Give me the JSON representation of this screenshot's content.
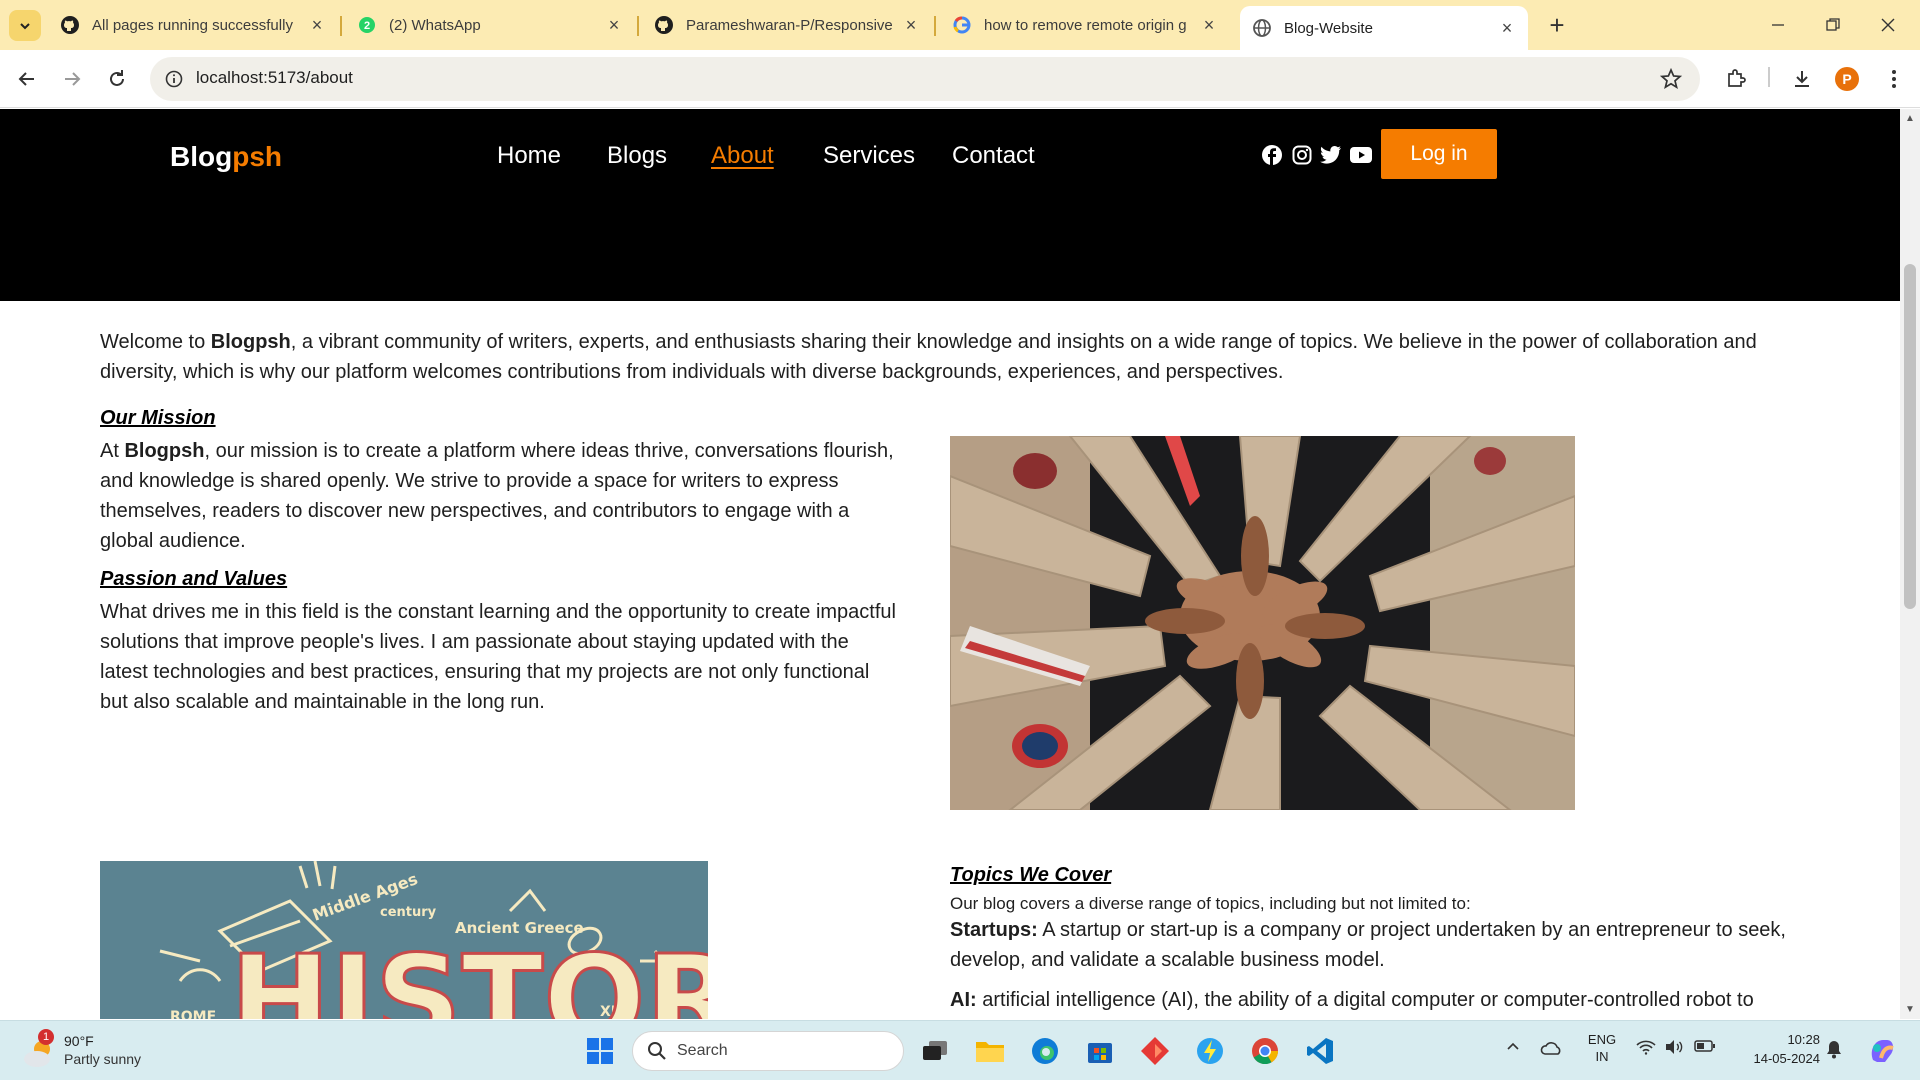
{
  "browser": {
    "tabs": [
      {
        "title": "All pages running successfully ·",
        "icon": "github-icon"
      },
      {
        "title": "(2) WhatsApp",
        "icon": "whatsapp-icon"
      },
      {
        "title": "Parameshwaran-P/Responsive-I",
        "icon": "github-icon"
      },
      {
        "title": "how to remove remote origin g",
        "icon": "google-icon"
      },
      {
        "title": "Blog-Website",
        "icon": "globe-icon",
        "active": true
      }
    ],
    "url": "localhost:5173/about",
    "profile_initial": "P"
  },
  "site": {
    "logo_main": "Blog",
    "logo_accent": "psh",
    "nav": [
      "Home",
      "Blogs",
      "About",
      "Services",
      "Contact"
    ],
    "active_nav": "About",
    "login_label": "Log in",
    "accent_color": "#f57c00"
  },
  "content": {
    "intro_pre": "Welcome to ",
    "brand": "Blogpsh",
    "intro_post": ", a vibrant community of writers, experts, and enthusiasts sharing their knowledge and insights on a wide range of topics. We believe in the power of collaboration and diversity, which is why our platform welcomes contributions from individuals with diverse backgrounds, experiences, and perspectives.",
    "mission_heading": "Our Mission",
    "mission_pre": "At ",
    "mission_post": ", our mission is to create a platform where ideas thrive, conversations flourish, and knowledge is shared openly. We strive to provide a space for writers to express themselves, readers to discover new perspectives, and contributors to engage with a global audience.",
    "passion_heading": "Passion and Values",
    "passion_text": "What drives me in this field is the constant learning and the opportunity to create impactful solutions that improve people's lives. I am passionate about staying updated with the latest technologies and best practices, ensuring that my projects are not only functional but also scalable and maintainable in the long run.",
    "topics_heading": "Topics We Cover",
    "topics_sub": "Our blog covers a diverse range of topics, including but not limited to:",
    "topics": [
      {
        "term": "Startups:",
        "desc": " A startup or start-up is a company or project undertaken by an entrepreneur to seek, develop, and validate a scalable business model."
      },
      {
        "term": "AI:",
        "desc": " artificial intelligence (AI), the ability of a digital computer or computer-controlled robot to"
      }
    ],
    "history_words": [
      "Middle Ages",
      "century",
      "Ancient Greece",
      "HISTORY",
      "ROME",
      "XIX"
    ]
  },
  "taskbar": {
    "weather_temp": "90°F",
    "weather_cond": "Partly sunny",
    "weather_badge": "1",
    "search_label": "Search",
    "lang_top": "ENG",
    "lang_bottom": "IN",
    "time": "10:28",
    "date": "14-05-2024"
  }
}
